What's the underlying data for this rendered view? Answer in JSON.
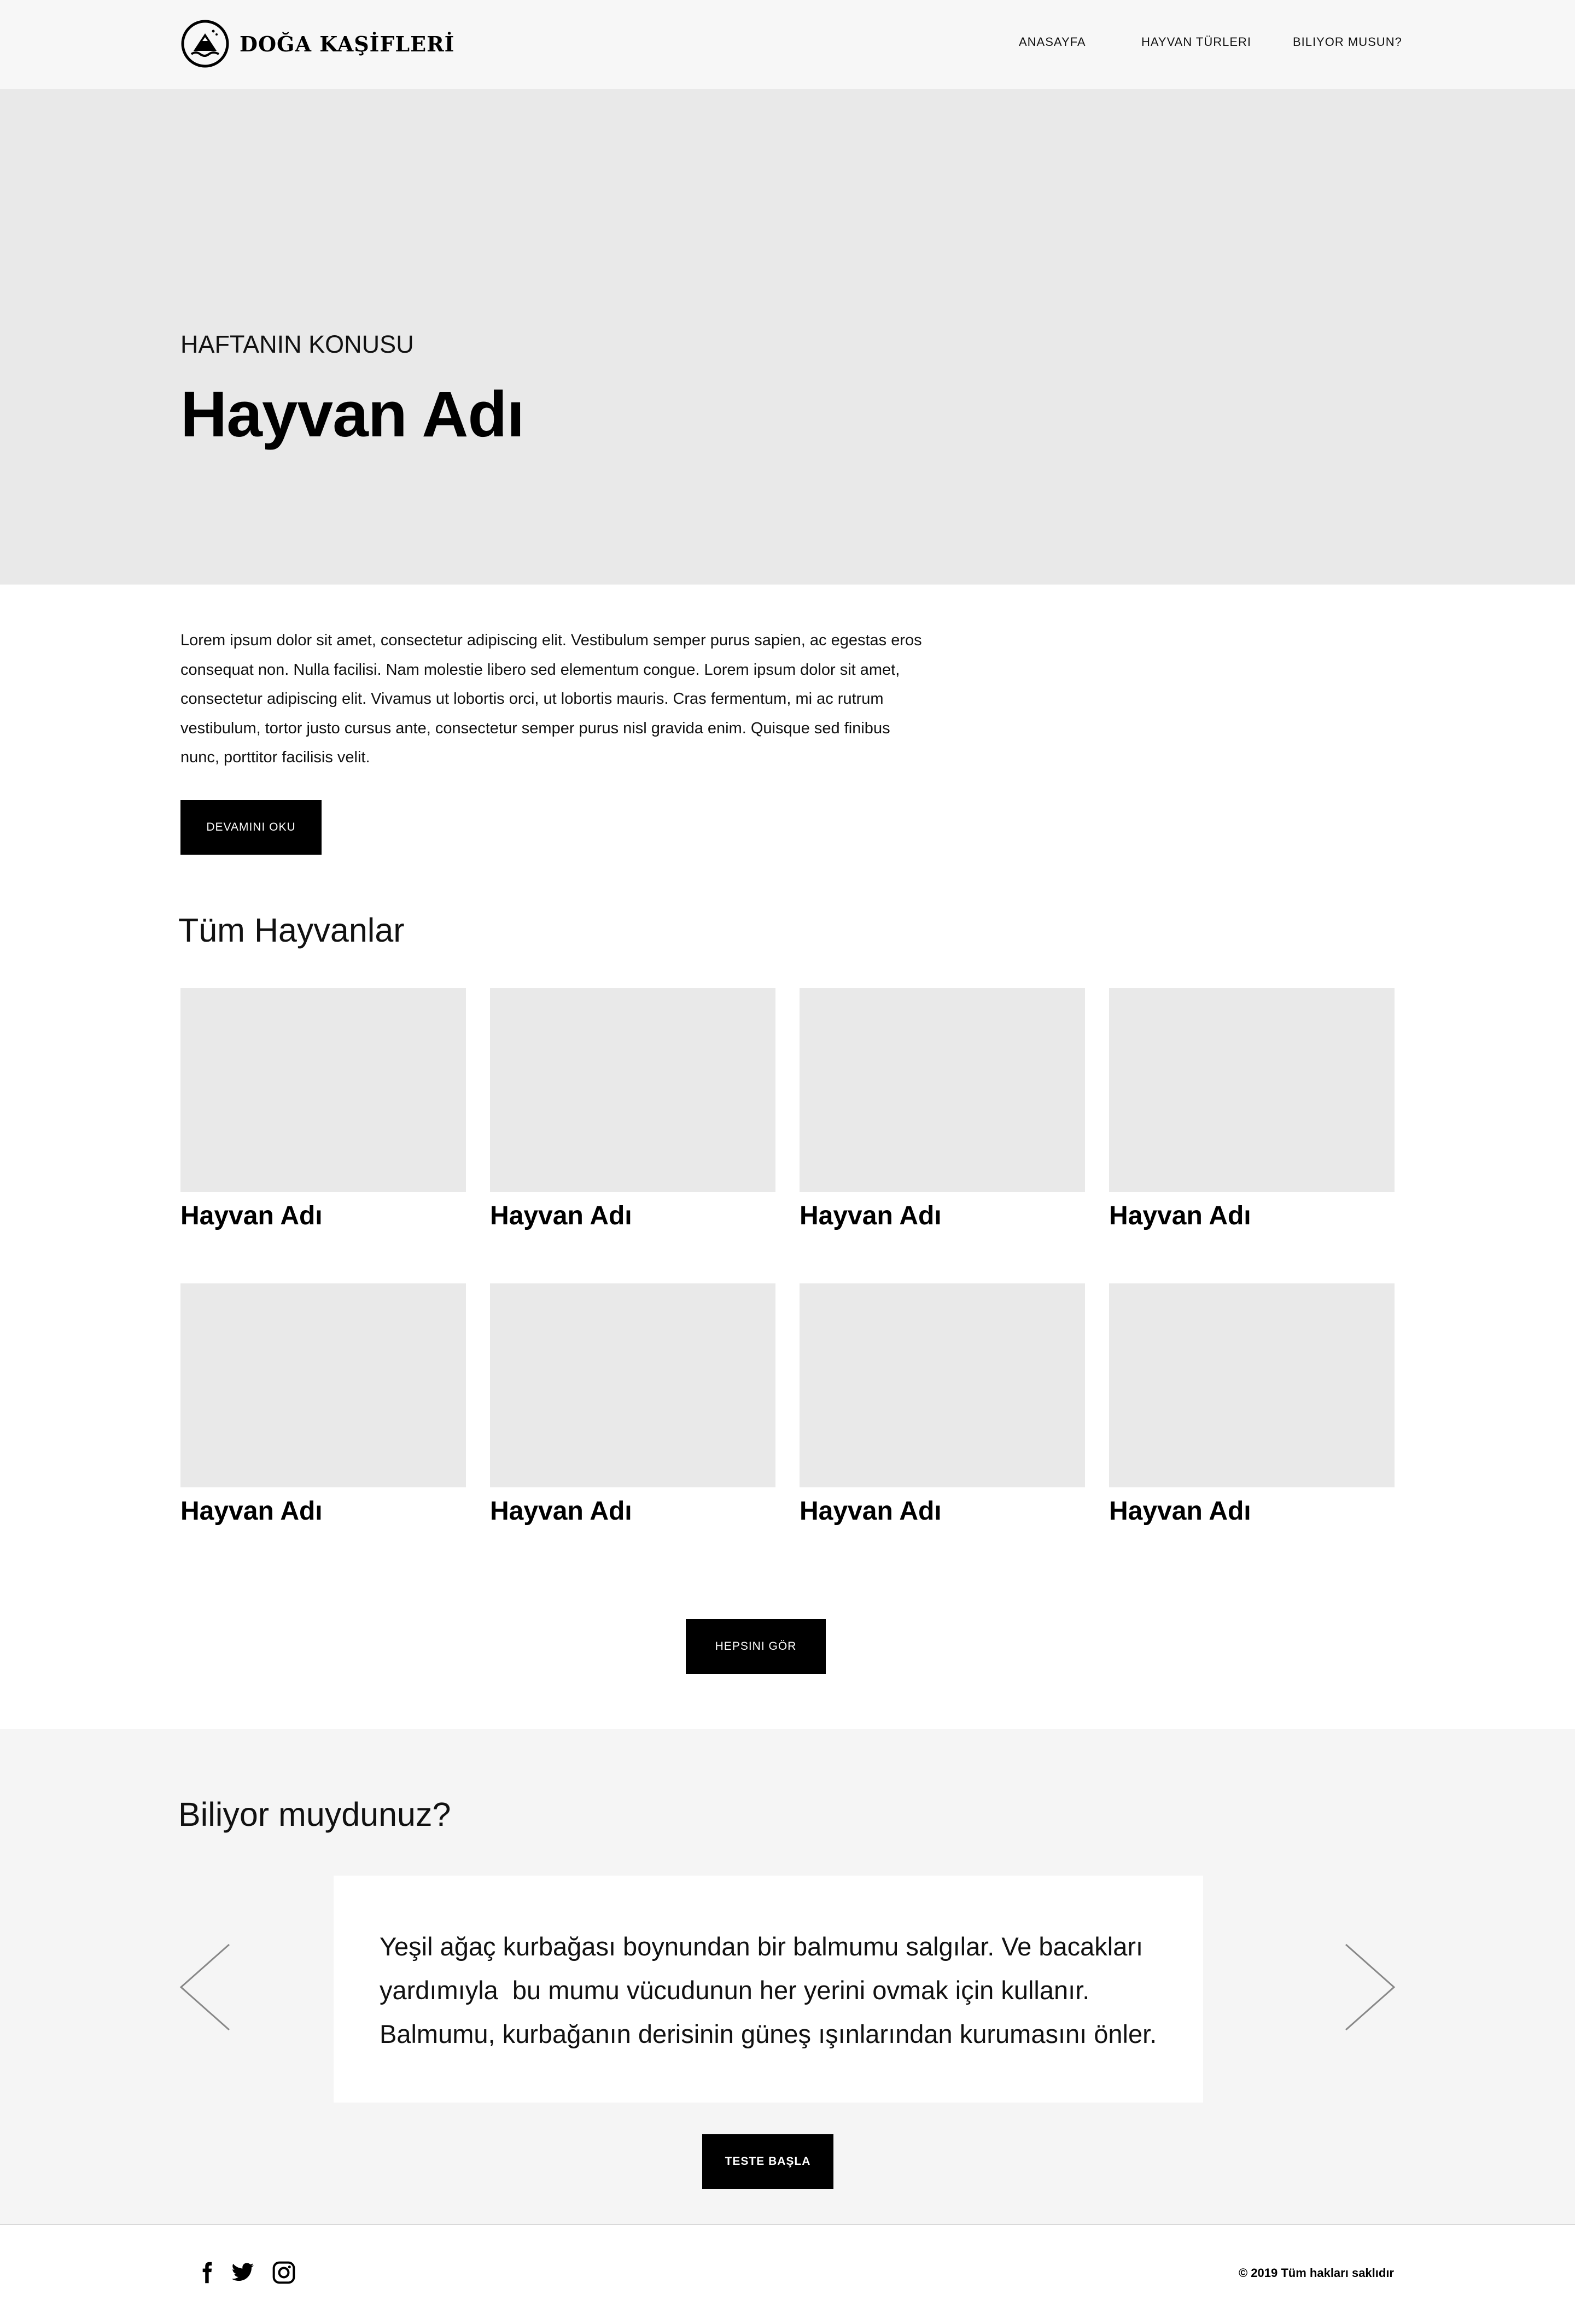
{
  "header": {
    "logo_text": "DOĞA KAŞİFLERİ",
    "nav": [
      "ANASAYFA",
      "HAYVAN TÜRLERI",
      "BILIYOR MUSUN?"
    ]
  },
  "hero": {
    "label": "HAFTANIN KONUSU",
    "title": "Hayvan Adı"
  },
  "intro": {
    "text": "Lorem ipsum dolor sit amet, consectetur adipiscing elit. Vestibulum semper purus sapien, ac egestas eros consequat non. Nulla facilisi. Nam molestie libero sed elementum congue. Lorem ipsum dolor sit amet, consectetur adipiscing elit. Vivamus ut lobortis orci, ut lobortis mauris. Cras fermentum, mi ac rutrum vestibulum, tortor justo cursus ante, consectetur semper purus nisl gravida enim. Quisque sed finibus nunc, porttitor facilisis velit.",
    "button": "DEVAMINI OKU"
  },
  "animals": {
    "title": "Tüm Hayvanlar",
    "items": [
      "Hayvan Adı",
      "Hayvan Adı",
      "Hayvan Adı",
      "Hayvan Adı",
      "Hayvan Adı",
      "Hayvan Adı",
      "Hayvan Adı",
      "Hayvan Adı"
    ],
    "button": "HEPSINI GÖR"
  },
  "facts": {
    "title": "Biliyor muydunuz?",
    "lines": [
      "Yeşil ağaç kurbağası boynundan bir balmumu salgılar. Ve bacakları",
      "yardımıyla  bu mumu vücudunun her yerini ovmak için kullanır.",
      "Balmumu, kurbağanın derisinin güneş ışınlarından kurumasını önler."
    ],
    "button": "TESTE BAŞLA"
  },
  "footer": {
    "social_icons": [
      "facebook-icon",
      "twitter-icon",
      "instagram-icon"
    ],
    "copyright": "© 2019 Tüm hakları saklıdır"
  }
}
